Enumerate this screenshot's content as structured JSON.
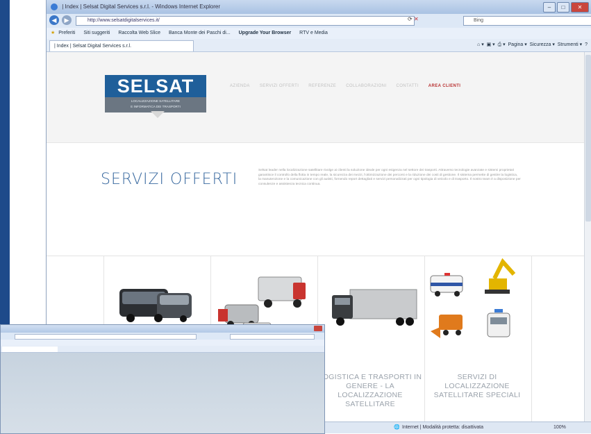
{
  "window": {
    "title": "| Index | Selsat Digital Services s.r.l. - Windows Internet Explorer",
    "url": "http://www.selsatdigitalservices.it/",
    "search_placeholder": "Bing",
    "tab_label": "| Index | Selsat Digital Services s.r.l."
  },
  "favorites_bar": {
    "favorites": "Preferiti",
    "items": [
      "Siti suggeriti",
      "Raccolta Web Slice",
      "Banca Monte dei Paschi di...",
      "Upgrade Your Browser",
      "RTV e Media"
    ]
  },
  "command_bar": {
    "items": [
      "Pagina",
      "Sicurezza",
      "Strumenti"
    ]
  },
  "site": {
    "logo_name": "SELSAT",
    "logo_tagline_1": "LOCALIZZAZIONE SATELLITARE",
    "logo_tagline_2": "E INFORMATICA DEI TRASPORTI",
    "menu": [
      "AZIENDA",
      "SERVIZI OFFERTI",
      "REFERENZE",
      "COLLABORAZIONI",
      "CONTATTI"
    ],
    "menu_client": "AREA CLIENTI",
    "section_title": "SERVIZI OFFERTI",
    "section_text": "Selsat leader nella localizzazione satellitare rivolge ai clienti la soluzione ideale per ogni esigenza nel settore dei trasporti. Attraverso tecnologie avanzate e sistemi proprietari garantisce il controllo della flotta in tempo reale, la sicurezza dei mezzi, l'ottimizzazione dei percorsi e la riduzione dei costi di gestione. Il sistema permette di gestire la logistica, la manutenzione e la comunicazione con gli autisti, fornendo report dettagliati e servizi personalizzati per ogni tipologia di veicolo e di trasporto. Il nostro team è a disposizione per consulenze e assistenza tecnica continua.",
    "services": [
      {
        "label": ""
      },
      {
        "label": ""
      },
      {
        "label": "LOGISTICA E TRASPORTI IN GENERE - LA LOCALIZZAZIONE SATELLITARE"
      },
      {
        "label": "SERVIZI DI LOCALIZZAZIONE SATELLITARE SPECIALI"
      }
    ]
  },
  "status_bar": {
    "zone": "Internet | Modalità protetta: disattivata",
    "zoom": "100%"
  },
  "colors": {
    "logo_blue": "#1f5f9a",
    "title_blue": "#3a6aa0",
    "client_red": "#b83030"
  }
}
